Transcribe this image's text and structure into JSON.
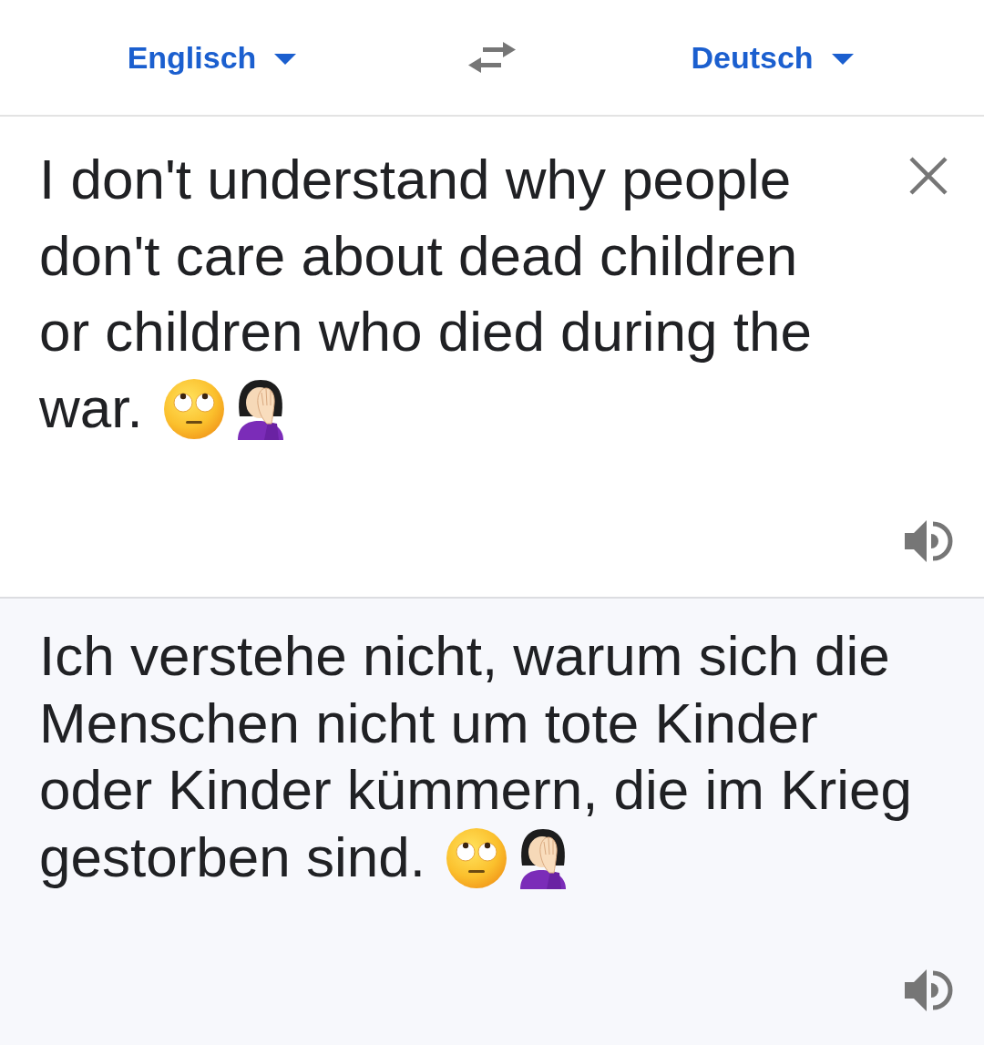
{
  "language_bar": {
    "source_language": "Englisch",
    "target_language": "Deutsch"
  },
  "input": {
    "value": "I don't understand why people don't care about dead children or children who died during the war."
  },
  "output": {
    "text": "Ich verstehe nicht, warum sich die Menschen nicht um tote Kinder oder Kinder kümmern, die im Krieg gestorben sind."
  }
}
